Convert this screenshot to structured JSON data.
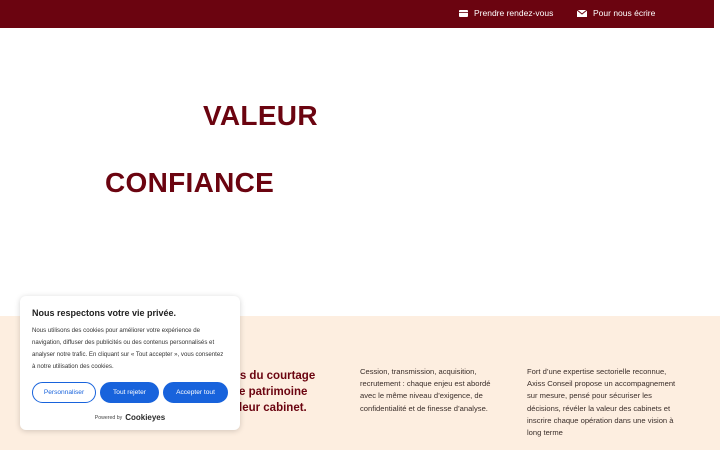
{
  "topbar": {
    "appointment_label": "Prendre rendez-vous",
    "write_label": "Pour nous écrire",
    "appointment_icon": "calendar-icon",
    "write_icon": "mail-icon"
  },
  "hero": {
    "word1": "VALEUR",
    "word2": "CONFIANCE"
  },
  "band": {
    "col1_lines": [
      "ts du courtage",
      "e patrimoine",
      "leur cabinet."
    ],
    "col2_text": "Cession, transmission, acquisition, recrutement : chaque enjeu est abordé avec le même niveau d’exigence, de confidentialité et de finesse d’analyse.",
    "col3_text": "Fort d’une expertise sectorielle reconnue, Axiss Conseil propose un accompagnement sur mesure, pensé pour sécuriser les décisions, révéler la valeur des cabinets et inscrire chaque opération dans une vision à long terme"
  },
  "cookie": {
    "title": "Nous respectons votre vie privée.",
    "text": "Nous utilisons des cookies pour améliorer votre expérience de navigation, diffuser des publicités ou des contenus personnalisés et analyser notre trafic. En cliquant sur « Tout accepter », vous consentez à notre utilisation des cookies.",
    "customize_label": "Personnaliser",
    "reject_label": "Tout rejeter",
    "accept_label": "Accepter tout",
    "powered_label": "Powered by",
    "brand": "Cookieyes"
  },
  "colors": {
    "brand": "#6b0410",
    "band_bg": "#fdeee0",
    "cookie_accent": "#1863dc"
  }
}
